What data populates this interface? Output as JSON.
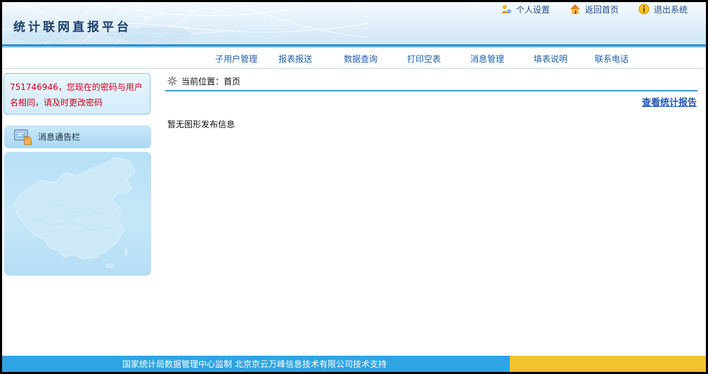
{
  "header": {
    "title": "统计联网直报平台",
    "links": [
      {
        "label": "个人设置",
        "icon": "user-settings-icon"
      },
      {
        "label": "返回首页",
        "icon": "home-icon"
      },
      {
        "label": "退出系统",
        "icon": "info-exit-icon"
      }
    ]
  },
  "nav": {
    "items": [
      "子用户管理",
      "报表报送",
      "数据查询",
      "打印空表",
      "消息管理",
      "填表说明",
      "联系电话"
    ]
  },
  "sidebar": {
    "warning": "751746946，您现在的密码与用户名相同，请及时更改密码",
    "notice_label": "消息通告栏"
  },
  "main": {
    "breadcrumb_label": "当前位置：",
    "breadcrumb_current": "首页",
    "report_link": "查看统计报告",
    "empty_message": "暂无图形发布信息"
  },
  "footer": {
    "text": "国家统计局数据管理中心监制 北京京云万峰信息技术有限公司技术支持"
  },
  "colors": {
    "accent_blue": "#2a8fd4",
    "nav_text": "#1d5fa8",
    "warning_red": "#d4001a",
    "footer_blue": "#2ea4e2",
    "footer_yellow": "#f2c22f"
  }
}
